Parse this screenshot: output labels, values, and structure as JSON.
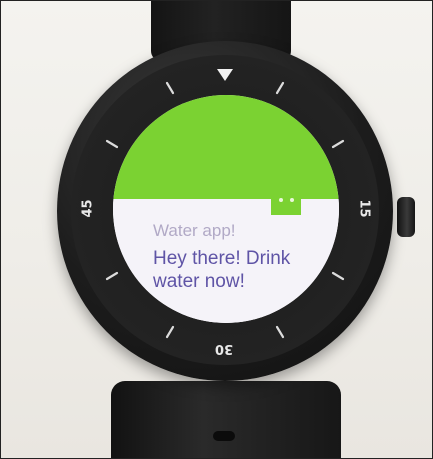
{
  "notification": {
    "app_name": "Water app!",
    "message": "Hey there! Drink water now!"
  },
  "bezel": {
    "labels": {
      "left": "45",
      "right": "15",
      "bottom": "30"
    }
  },
  "colors": {
    "accent_green": "#7bd232",
    "card_background": "#f5f3f9",
    "title_text": "#b1a9c6",
    "message_text": "#5f54a6"
  },
  "icons": {
    "app_icon": "green-face-icon",
    "bezel_marker": "triangle-marker-icon"
  }
}
